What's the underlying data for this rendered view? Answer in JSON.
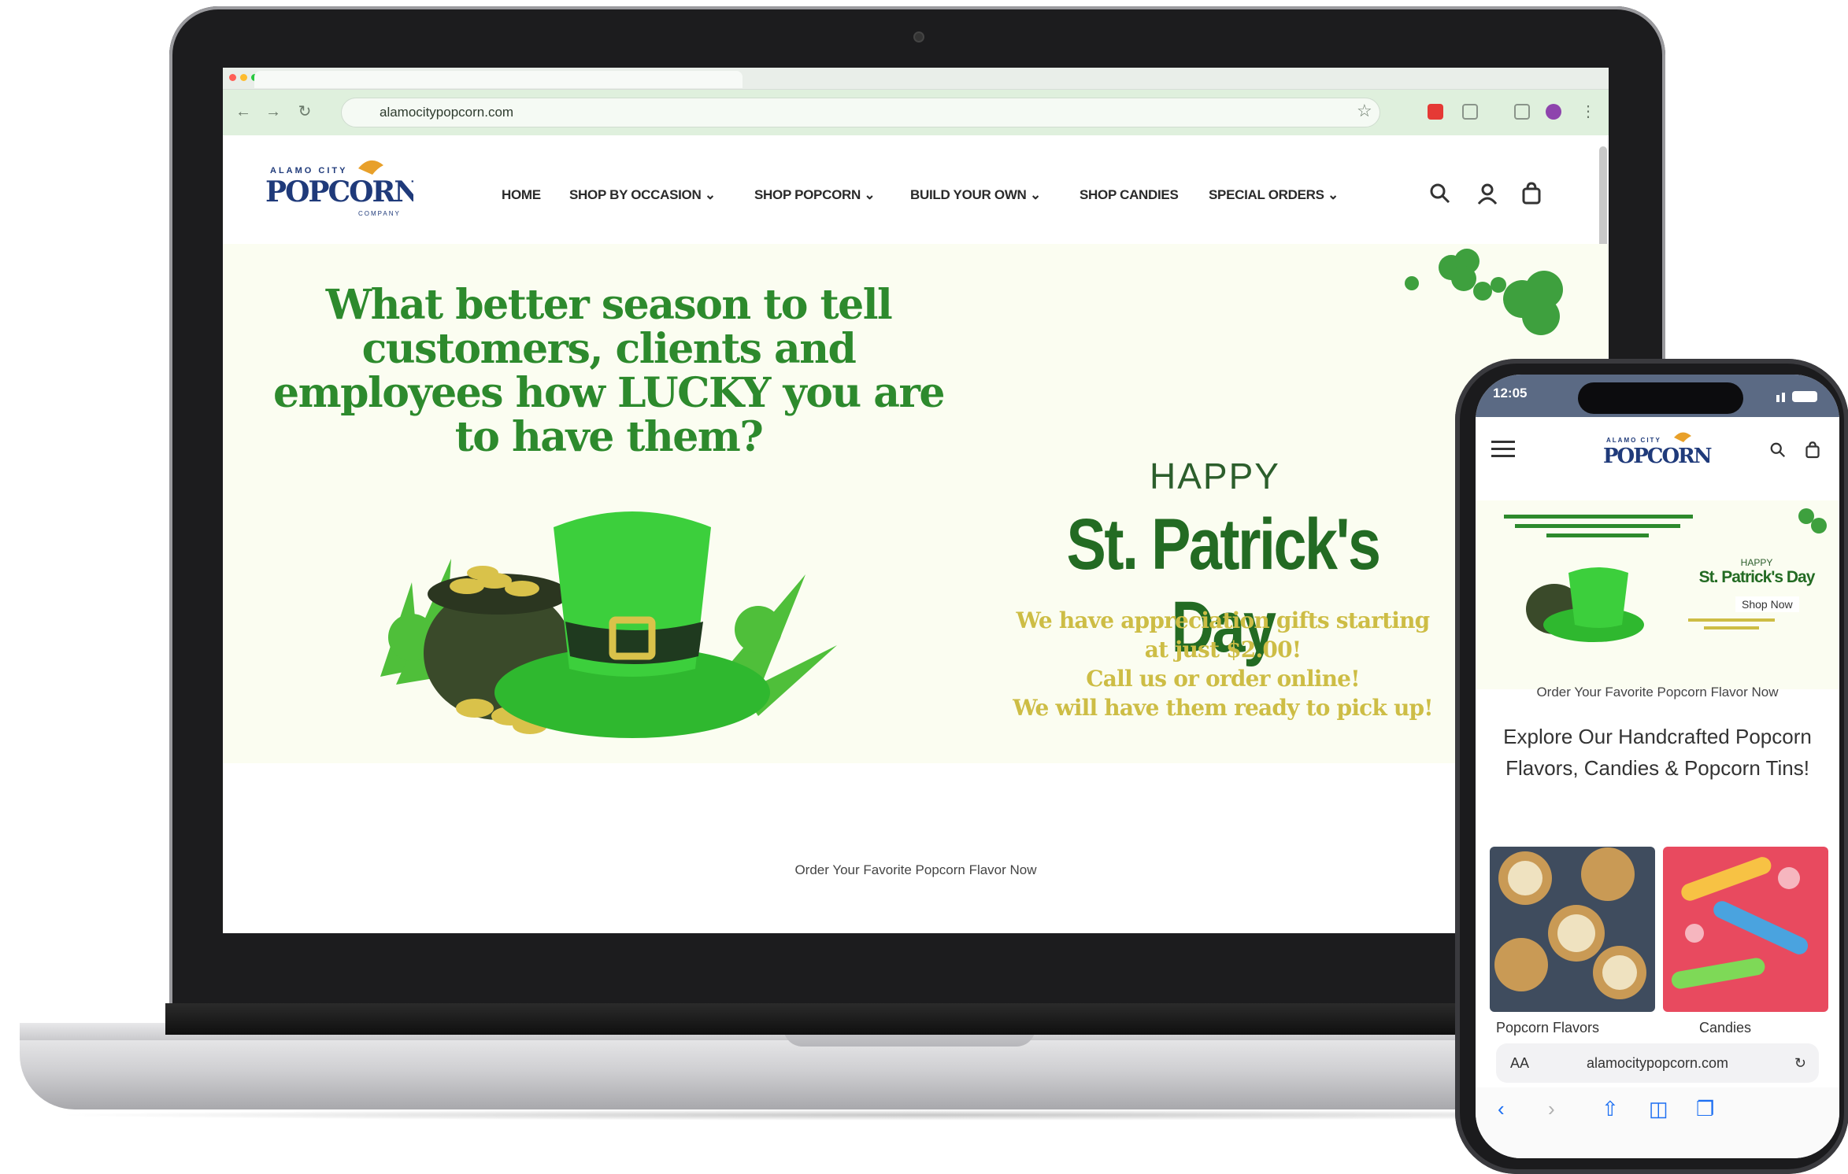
{
  "browser": {
    "url": "alamocitypopcorn.com"
  },
  "site": {
    "logo": {
      "top": "ALAMO CITY",
      "main": "POPCORN",
      "bottom": "COMPANY"
    },
    "nav": [
      {
        "label": "HOME"
      },
      {
        "label": "SHOP BY OCCASION ⌄"
      },
      {
        "label": "SHOP POPCORN ⌄"
      },
      {
        "label": "BUILD YOUR OWN ⌄"
      },
      {
        "label": "SHOP CANDIES"
      },
      {
        "label": "SPECIAL ORDERS ⌄"
      }
    ]
  },
  "hero": {
    "headline": "What better season to tell customers, clients and employees how LUCKY you are to have them?",
    "happy": "HAPPY",
    "title": "St. Patrick's Day",
    "gifts_line1": "We have appreciation gifts starting",
    "gifts_line2": "at just $2.00!",
    "gifts_line3": "Call us or order online!",
    "gifts_line4": "We will have them ready to pick up!"
  },
  "order_text": "Order Your Favorite Popcorn Flavor Now",
  "phone": {
    "time": "12:05",
    "hero_title": "St. Patrick's Day",
    "hero_happy": "HAPPY",
    "shop_now": "Shop Now",
    "order_text": "Order Your Favorite Popcorn Flavor Now",
    "explore": "Explore Our Handcrafted Popcorn Flavors, Candies & Popcorn Tins!",
    "card1": "Popcorn Flavors",
    "card2": "Candies",
    "url": "alamocitypopcorn.com",
    "url_prefix": "AA"
  },
  "colors": {
    "brand_navy": "#1f3a7a",
    "hero_green": "#2d8a2d",
    "gold": "#cdbd45"
  }
}
